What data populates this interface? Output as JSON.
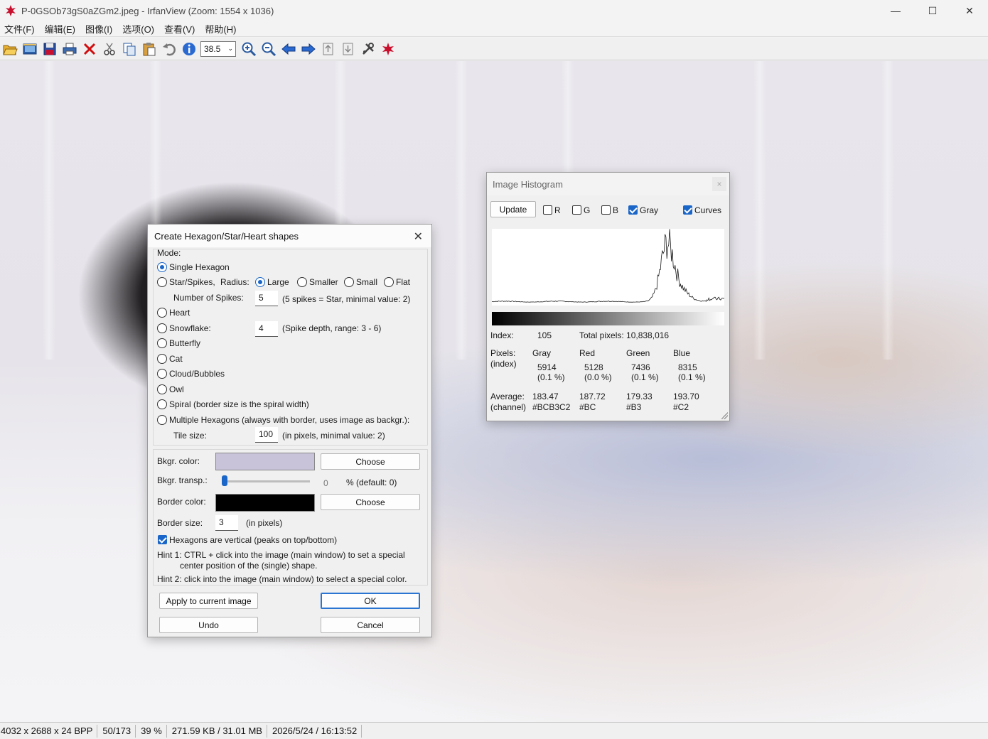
{
  "window": {
    "title": "P-0GSOb73gS0aZGm2.jpeg - IrfanView (Zoom: 1554 x 1036)",
    "minimize": "—",
    "maximize": "☐",
    "close": "✕"
  },
  "menu": [
    "文件(F)",
    "编辑(E)",
    "图像(I)",
    "选项(O)",
    "查看(V)",
    "帮助(H)"
  ],
  "toolbar": {
    "zoom_value": "38.5",
    "icons": [
      "open-folder-icon",
      "slideshow-icon",
      "save-icon",
      "print-icon",
      "delete-icon",
      "cut-icon",
      "copy-icon",
      "paste-icon",
      "undo-icon",
      "info-icon",
      "zoom-in-icon",
      "zoom-out-icon",
      "previous-icon",
      "next-icon",
      "first-page-icon",
      "last-page-icon",
      "settings-icon",
      "irfanview-logo-icon"
    ]
  },
  "statusbar": {
    "dimensions": "4032 x 2688 x 24 BPP",
    "index": "50/173",
    "zoom": "39 %",
    "filesize": "271.59 KB / 31.01 MB",
    "datetime": "2026/5/24 / 16:13:52"
  },
  "shapes_dialog": {
    "title": "Create Hexagon/Star/Heart shapes",
    "close": "✕",
    "mode_label": "Mode:",
    "modes": {
      "single_hexagon": "Single Hexagon",
      "star_spikes": "Star/Spikes,",
      "heart": "Heart",
      "snowflake": "Snowflake:",
      "butterfly": "Butterfly",
      "cat": "Cat",
      "cloud": "Cloud/Bubbles",
      "owl": "Owl",
      "spiral": "Spiral (border size is the spiral width)",
      "multiple": "Multiple Hexagons (always with border, uses image as backgr.):"
    },
    "radius_label": "Radius:",
    "radius_options": [
      "Large",
      "Smaller",
      "Small",
      "Flat"
    ],
    "spikes_label": "Number of Spikes:",
    "spikes_value": "5",
    "spikes_hint": "(5 spikes = Star, minimal value: 2)",
    "snowflake_value": "4",
    "snowflake_hint": "(Spike depth, range: 3 - 6)",
    "tile_label": "Tile size:",
    "tile_value": "100",
    "tile_hint": "(in pixels, minimal value: 2)",
    "bkgr_color_label": "Bkgr. color:",
    "bkgr_color": "#c8c3d8",
    "choose_label": "Choose",
    "bkgr_transp_label": "Bkgr. transp.:",
    "bkgr_transp_value": "0",
    "bkgr_transp_hint": "% (default: 0)",
    "border_color_label": "Border color:",
    "border_color": "#000000",
    "border_size_label": "Border size:",
    "border_size_value": "3",
    "border_size_hint": "(in pixels)",
    "vertical_label": "Hexagons are vertical (peaks on top/bottom)",
    "hint1_line1": "Hint 1: CTRL + click into the image (main window) to set a special",
    "hint1_line2": "center position of the (single) shape.",
    "hint2": "Hint 2: click into the image (main window) to select a special color.",
    "apply_label": "Apply to current image",
    "ok_label": "OK",
    "undo_label": "Undo",
    "cancel_label": "Cancel"
  },
  "histogram": {
    "title": "Image Histogram",
    "close": "×",
    "update_label": "Update",
    "r_label": "R",
    "g_label": "G",
    "b_label": "B",
    "gray_label": "Gray",
    "curves_label": "Curves",
    "index_label": "Index:",
    "index_value": "105",
    "total_label": "Total pixels: 10,838,016",
    "pixels_label": "Pixels:",
    "index_paren": "(index)",
    "columns": [
      "Gray",
      "Red",
      "Green",
      "Blue"
    ],
    "pixel_counts": [
      "5914",
      "5128",
      "7436",
      "8315"
    ],
    "pixel_pcts": [
      "(0.1 %)",
      "(0.0 %)",
      "(0.1 %)",
      "(0.1 %)"
    ],
    "average_label": "Average:",
    "channel_label": "(channel)",
    "averages": [
      "183.47",
      "187.72",
      "179.33",
      "193.70"
    ],
    "hex_values": [
      "#BCB3C2",
      "#BC",
      "#B3",
      "#C2"
    ]
  }
}
